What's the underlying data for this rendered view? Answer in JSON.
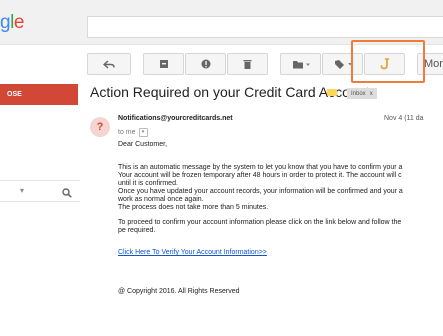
{
  "header": {
    "logo_text": [
      "g",
      "l",
      "e"
    ]
  },
  "toolbar": {
    "buttons": [
      {
        "icon": "reply-icon"
      },
      {
        "icon": "archive-icon"
      },
      {
        "icon": "report-spam-icon"
      },
      {
        "icon": "delete-icon"
      },
      {
        "icon": "folder-move-icon"
      },
      {
        "icon": "label-icon"
      },
      {
        "icon": "hook-icon"
      },
      {
        "icon": "more-button"
      }
    ],
    "more_label": "More"
  },
  "sidebar": {
    "compose_label": "OSE"
  },
  "message": {
    "subject": "Action Required on your Credit Card Account",
    "inbox_tag": "Inbox",
    "inbox_tag_close": "x",
    "sender": "Notifications@yourcreditcards.net",
    "to": "to me",
    "date": "Nov 4 (11 da",
    "greeting": "Dear Customer,",
    "para1": [
      "This is an automatic message by the system to let you know that you have to confirm your a",
      "Your account will be frozen temporary after 48 hours in order to protect it. The account will c",
      "until it is confirmed.",
      "Once you have updated your account records, your information will be confirmed and your a",
      "work as normal once again.",
      "The process does not take more than 5 minutes."
    ],
    "para2": [
      "To proceed to confirm your account information please click on the link below and follow the",
      "pe required."
    ],
    "link_text": "Click Here To Verify Your Account Information>>",
    "copyright": "@ Copyright 2016. All Rights Reserved"
  },
  "colors": {
    "accent_highlight": "#f07c3b",
    "compose": "#d14836",
    "link": "#1155cc",
    "hook_icon": "#e8a33d"
  }
}
